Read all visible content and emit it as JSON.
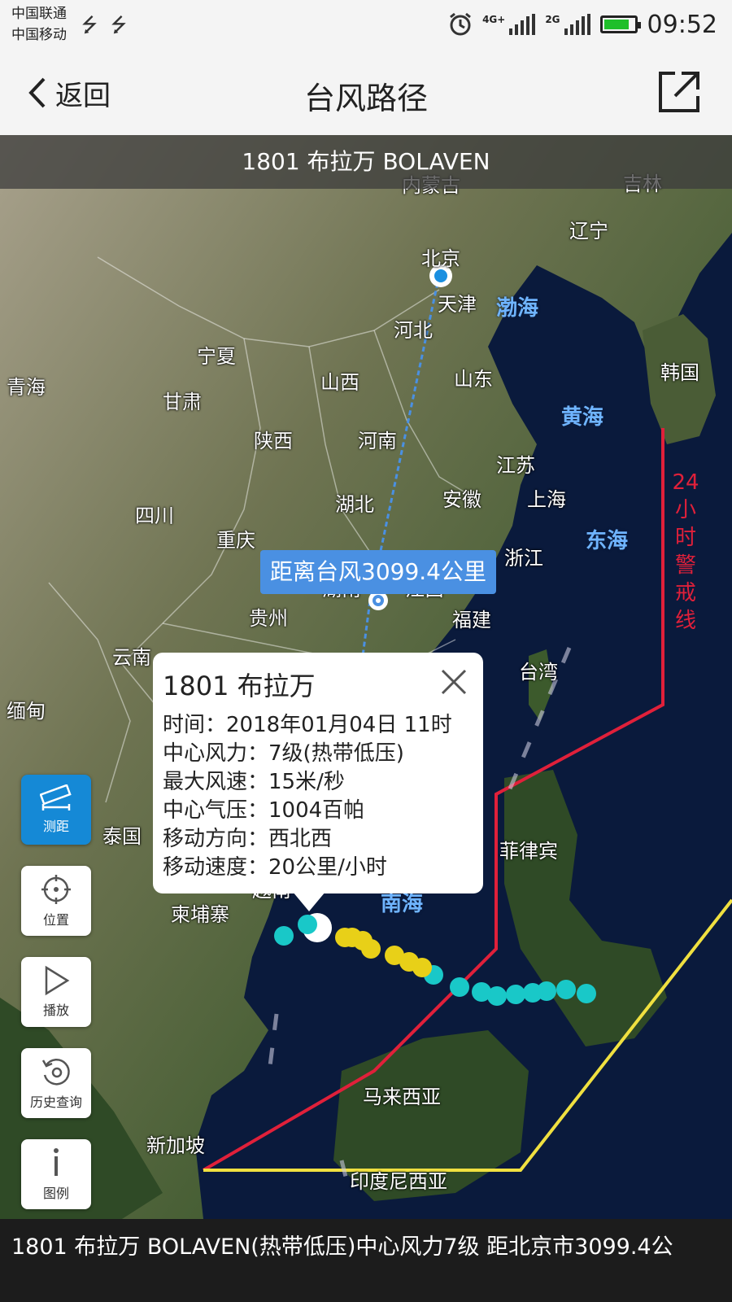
{
  "status_bar": {
    "carrier_1": "中国联通",
    "carrier_2": "中国移动",
    "net_1": "4G+",
    "net_2": "2G",
    "time": "09:52",
    "icons": [
      "usb-icon",
      "usb-icon",
      "alarm-icon",
      "signal-icon",
      "signal-icon",
      "battery-icon"
    ],
    "battery_color": "#1fbf2a"
  },
  "nav": {
    "back_label": "返回",
    "title": "台风路径",
    "share_icon": "share-icon"
  },
  "map": {
    "header": "1801 布拉万 BOLAVEN",
    "regions": [
      "内蒙古",
      "吉林",
      "辽宁",
      "北京",
      "天津",
      "河北",
      "宁夏",
      "青海",
      "甘肃",
      "山西",
      "山东",
      "韩国",
      "陕西",
      "河南",
      "江苏",
      "四川",
      "湖北",
      "安徽",
      "上海",
      "重庆",
      "浙江",
      "湖南",
      "江西",
      "贵州",
      "福建",
      "云南",
      "台湾",
      "缅甸",
      "泰国",
      "菲律宾",
      "越南",
      "柬埔寨",
      "马来西亚",
      "新加坡",
      "印度尼西亚"
    ],
    "seas": [
      "渤海",
      "黄海",
      "东海",
      "南海"
    ],
    "warning_line_label": "24小时警戒线",
    "distance_label": "距离台风3099.4公里",
    "colors": {
      "warning_line_24h": "#e0203a",
      "warning_line_48h": "#f0e040",
      "track_depression": "#19c8c8",
      "track_storm": "#e8d018",
      "distance_line": "#4a90e2"
    }
  },
  "popup": {
    "title": "1801 布拉万",
    "rows": [
      {
        "label": "时间：",
        "value": "2018年01月04日 11时"
      },
      {
        "label": "中心风力：",
        "value": "7级(热带低压)"
      },
      {
        "label": "最大风速：",
        "value": "15米/秒"
      },
      {
        "label": "中心气压：",
        "value": "1004百帕"
      },
      {
        "label": "移动方向：",
        "value": "西北西"
      },
      {
        "label": "移动速度：",
        "value": "20公里/小时"
      }
    ]
  },
  "tools": [
    {
      "label": "测距",
      "icon": "ruler-icon",
      "active": true
    },
    {
      "label": "位置",
      "icon": "crosshair-icon",
      "active": false
    },
    {
      "label": "播放",
      "icon": "play-icon",
      "active": false
    },
    {
      "label": "历史查询",
      "icon": "history-icon",
      "active": false
    },
    {
      "label": "图例",
      "icon": "info-icon",
      "active": false
    }
  ],
  "ticker": "1801 布拉万 BOLAVEN(热带低压)中心风力7级 距北京市3099.4公"
}
